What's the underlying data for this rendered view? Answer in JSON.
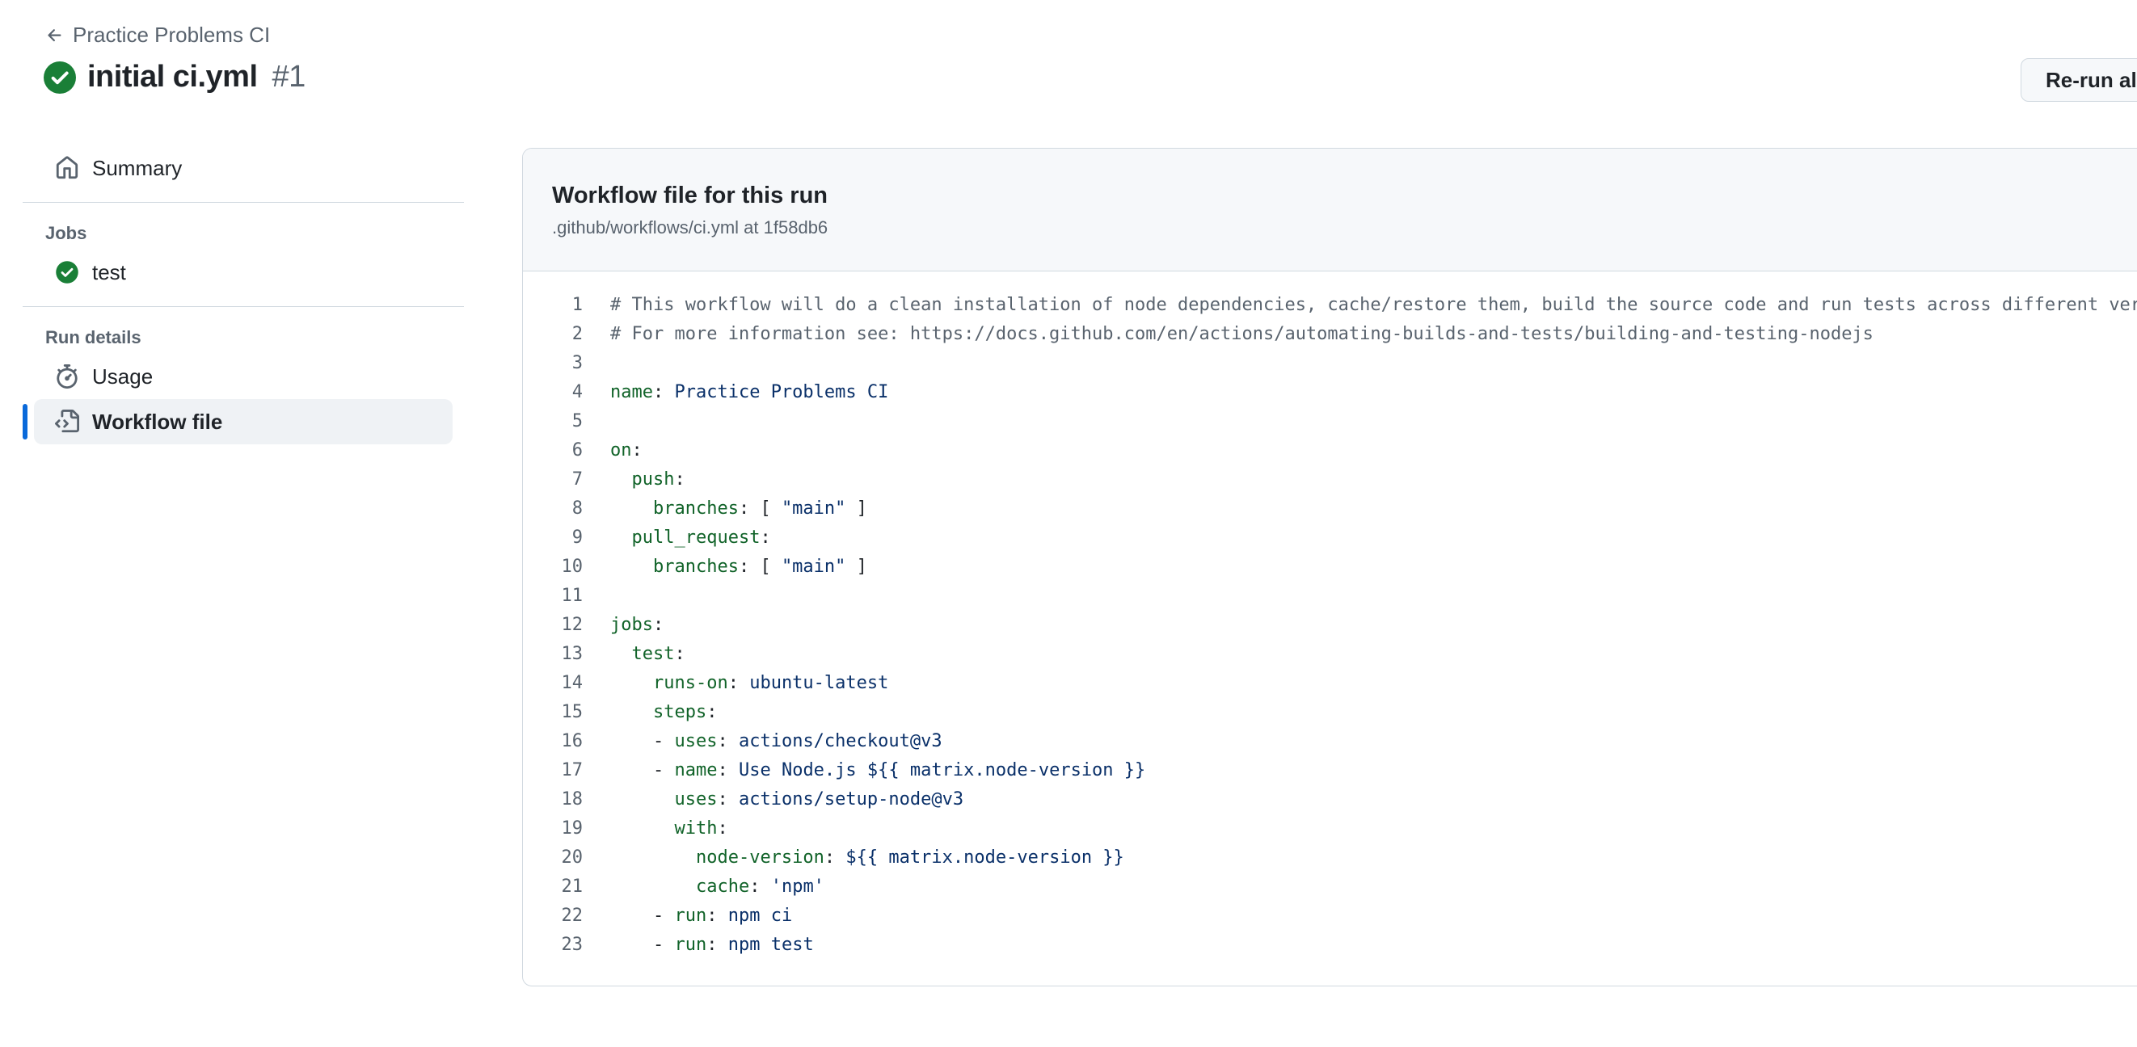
{
  "header": {
    "back_label": "Practice Problems CI",
    "run_title": "initial ci.yml",
    "run_number": "#1",
    "rerun_label": "Re-run all jobs"
  },
  "sidebar": {
    "summary_label": "Summary",
    "jobs_heading": "Jobs",
    "jobs": [
      {
        "label": "test",
        "status": "success"
      }
    ],
    "run_details_heading": "Run details",
    "usage_label": "Usage",
    "workflow_file_label": "Workflow file"
  },
  "panel": {
    "title": "Workflow file for this run",
    "subtitle": ".github/workflows/ci.yml at 1f58db6"
  },
  "code_lines": [
    {
      "n": "1",
      "tokens": [
        {
          "t": "# This workflow will do a clean installation of node dependencies, cache/restore them, build the source code and run tests across different versions of node",
          "c": "comment"
        }
      ]
    },
    {
      "n": "2",
      "tokens": [
        {
          "t": "# For more information see: https://docs.github.com/en/actions/automating-builds-and-tests/building-and-testing-nodejs",
          "c": "comment"
        }
      ]
    },
    {
      "n": "3",
      "tokens": []
    },
    {
      "n": "4",
      "tokens": [
        {
          "t": "name",
          "c": "key"
        },
        {
          "t": ": ",
          "c": "punct"
        },
        {
          "t": "Practice Problems CI",
          "c": "val"
        }
      ]
    },
    {
      "n": "5",
      "tokens": []
    },
    {
      "n": "6",
      "tokens": [
        {
          "t": "on",
          "c": "key"
        },
        {
          "t": ":",
          "c": "punct"
        }
      ]
    },
    {
      "n": "7",
      "tokens": [
        {
          "t": "  ",
          "c": "punct"
        },
        {
          "t": "push",
          "c": "key"
        },
        {
          "t": ":",
          "c": "punct"
        }
      ]
    },
    {
      "n": "8",
      "tokens": [
        {
          "t": "    ",
          "c": "punct"
        },
        {
          "t": "branches",
          "c": "key"
        },
        {
          "t": ": [ ",
          "c": "punct"
        },
        {
          "t": "\"main\"",
          "c": "val"
        },
        {
          "t": " ]",
          "c": "punct"
        }
      ]
    },
    {
      "n": "9",
      "tokens": [
        {
          "t": "  ",
          "c": "punct"
        },
        {
          "t": "pull_request",
          "c": "key"
        },
        {
          "t": ":",
          "c": "punct"
        }
      ]
    },
    {
      "n": "10",
      "tokens": [
        {
          "t": "    ",
          "c": "punct"
        },
        {
          "t": "branches",
          "c": "key"
        },
        {
          "t": ": [ ",
          "c": "punct"
        },
        {
          "t": "\"main\"",
          "c": "val"
        },
        {
          "t": " ]",
          "c": "punct"
        }
      ]
    },
    {
      "n": "11",
      "tokens": []
    },
    {
      "n": "12",
      "tokens": [
        {
          "t": "jobs",
          "c": "key"
        },
        {
          "t": ":",
          "c": "punct"
        }
      ]
    },
    {
      "n": "13",
      "tokens": [
        {
          "t": "  ",
          "c": "punct"
        },
        {
          "t": "test",
          "c": "key"
        },
        {
          "t": ":",
          "c": "punct"
        }
      ]
    },
    {
      "n": "14",
      "tokens": [
        {
          "t": "    ",
          "c": "punct"
        },
        {
          "t": "runs-on",
          "c": "key"
        },
        {
          "t": ": ",
          "c": "punct"
        },
        {
          "t": "ubuntu-latest",
          "c": "val"
        }
      ]
    },
    {
      "n": "15",
      "tokens": [
        {
          "t": "    ",
          "c": "punct"
        },
        {
          "t": "steps",
          "c": "key"
        },
        {
          "t": ":",
          "c": "punct"
        }
      ]
    },
    {
      "n": "16",
      "tokens": [
        {
          "t": "    - ",
          "c": "punct"
        },
        {
          "t": "uses",
          "c": "key"
        },
        {
          "t": ": ",
          "c": "punct"
        },
        {
          "t": "actions/checkout@v3",
          "c": "val"
        }
      ]
    },
    {
      "n": "17",
      "tokens": [
        {
          "t": "    - ",
          "c": "punct"
        },
        {
          "t": "name",
          "c": "key"
        },
        {
          "t": ": ",
          "c": "punct"
        },
        {
          "t": "Use Node.js ${{ matrix.node-version }}",
          "c": "val"
        }
      ]
    },
    {
      "n": "18",
      "tokens": [
        {
          "t": "      ",
          "c": "punct"
        },
        {
          "t": "uses",
          "c": "key"
        },
        {
          "t": ": ",
          "c": "punct"
        },
        {
          "t": "actions/setup-node@v3",
          "c": "val"
        }
      ]
    },
    {
      "n": "19",
      "tokens": [
        {
          "t": "      ",
          "c": "punct"
        },
        {
          "t": "with",
          "c": "key"
        },
        {
          "t": ":",
          "c": "punct"
        }
      ]
    },
    {
      "n": "20",
      "tokens": [
        {
          "t": "        ",
          "c": "punct"
        },
        {
          "t": "node-version",
          "c": "key"
        },
        {
          "t": ": ",
          "c": "punct"
        },
        {
          "t": "${{ matrix.node-version }}",
          "c": "val"
        }
      ]
    },
    {
      "n": "21",
      "tokens": [
        {
          "t": "        ",
          "c": "punct"
        },
        {
          "t": "cache",
          "c": "key"
        },
        {
          "t": ": ",
          "c": "punct"
        },
        {
          "t": "'npm'",
          "c": "val"
        }
      ]
    },
    {
      "n": "22",
      "tokens": [
        {
          "t": "    - ",
          "c": "punct"
        },
        {
          "t": "run",
          "c": "key"
        },
        {
          "t": ": ",
          "c": "punct"
        },
        {
          "t": "npm ci",
          "c": "val"
        }
      ]
    },
    {
      "n": "23",
      "tokens": [
        {
          "t": "    - ",
          "c": "punct"
        },
        {
          "t": "run",
          "c": "key"
        },
        {
          "t": ": ",
          "c": "punct"
        },
        {
          "t": "npm test",
          "c": "val"
        }
      ]
    }
  ],
  "icons": {
    "back": "arrow-left-icon",
    "run_status": "check-circle-fill-icon",
    "summary": "home-icon",
    "job_status": "check-circle-fill-icon",
    "usage": "stopwatch-icon",
    "workflow_file": "file-code-icon"
  },
  "colors": {
    "success": "#1a7f37",
    "accent": "#0969da",
    "yaml_key": "#116329",
    "yaml_value": "#0a3069",
    "comment": "#59636e"
  }
}
